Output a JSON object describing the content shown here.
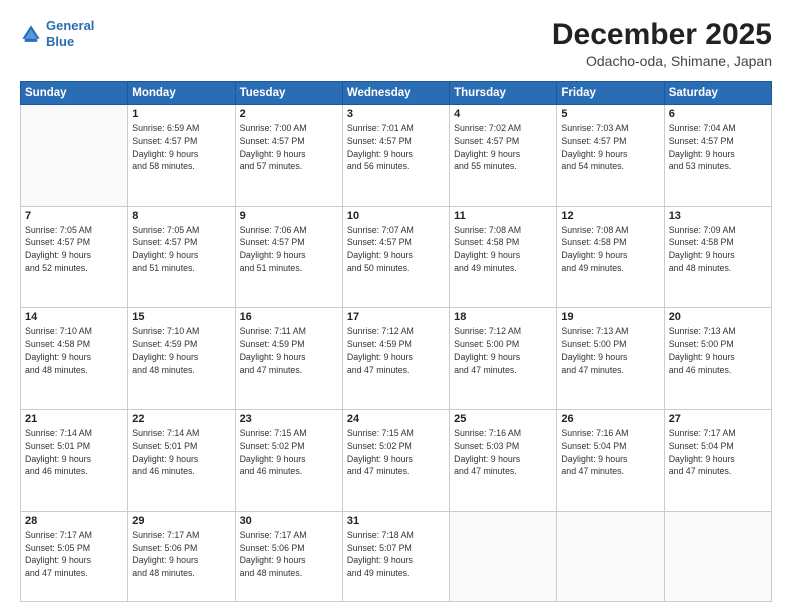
{
  "logo": {
    "line1": "General",
    "line2": "Blue"
  },
  "header": {
    "month": "December 2025",
    "location": "Odacho-oda, Shimane, Japan"
  },
  "weekdays": [
    "Sunday",
    "Monday",
    "Tuesday",
    "Wednesday",
    "Thursday",
    "Friday",
    "Saturday"
  ],
  "weeks": [
    [
      {
        "day": "",
        "info": ""
      },
      {
        "day": "1",
        "info": "Sunrise: 6:59 AM\nSunset: 4:57 PM\nDaylight: 9 hours\nand 58 minutes."
      },
      {
        "day": "2",
        "info": "Sunrise: 7:00 AM\nSunset: 4:57 PM\nDaylight: 9 hours\nand 57 minutes."
      },
      {
        "day": "3",
        "info": "Sunrise: 7:01 AM\nSunset: 4:57 PM\nDaylight: 9 hours\nand 56 minutes."
      },
      {
        "day": "4",
        "info": "Sunrise: 7:02 AM\nSunset: 4:57 PM\nDaylight: 9 hours\nand 55 minutes."
      },
      {
        "day": "5",
        "info": "Sunrise: 7:03 AM\nSunset: 4:57 PM\nDaylight: 9 hours\nand 54 minutes."
      },
      {
        "day": "6",
        "info": "Sunrise: 7:04 AM\nSunset: 4:57 PM\nDaylight: 9 hours\nand 53 minutes."
      }
    ],
    [
      {
        "day": "7",
        "info": "Sunrise: 7:05 AM\nSunset: 4:57 PM\nDaylight: 9 hours\nand 52 minutes."
      },
      {
        "day": "8",
        "info": "Sunrise: 7:05 AM\nSunset: 4:57 PM\nDaylight: 9 hours\nand 51 minutes."
      },
      {
        "day": "9",
        "info": "Sunrise: 7:06 AM\nSunset: 4:57 PM\nDaylight: 9 hours\nand 51 minutes."
      },
      {
        "day": "10",
        "info": "Sunrise: 7:07 AM\nSunset: 4:57 PM\nDaylight: 9 hours\nand 50 minutes."
      },
      {
        "day": "11",
        "info": "Sunrise: 7:08 AM\nSunset: 4:58 PM\nDaylight: 9 hours\nand 49 minutes."
      },
      {
        "day": "12",
        "info": "Sunrise: 7:08 AM\nSunset: 4:58 PM\nDaylight: 9 hours\nand 49 minutes."
      },
      {
        "day": "13",
        "info": "Sunrise: 7:09 AM\nSunset: 4:58 PM\nDaylight: 9 hours\nand 48 minutes."
      }
    ],
    [
      {
        "day": "14",
        "info": "Sunrise: 7:10 AM\nSunset: 4:58 PM\nDaylight: 9 hours\nand 48 minutes."
      },
      {
        "day": "15",
        "info": "Sunrise: 7:10 AM\nSunset: 4:59 PM\nDaylight: 9 hours\nand 48 minutes."
      },
      {
        "day": "16",
        "info": "Sunrise: 7:11 AM\nSunset: 4:59 PM\nDaylight: 9 hours\nand 47 minutes."
      },
      {
        "day": "17",
        "info": "Sunrise: 7:12 AM\nSunset: 4:59 PM\nDaylight: 9 hours\nand 47 minutes."
      },
      {
        "day": "18",
        "info": "Sunrise: 7:12 AM\nSunset: 5:00 PM\nDaylight: 9 hours\nand 47 minutes."
      },
      {
        "day": "19",
        "info": "Sunrise: 7:13 AM\nSunset: 5:00 PM\nDaylight: 9 hours\nand 47 minutes."
      },
      {
        "day": "20",
        "info": "Sunrise: 7:13 AM\nSunset: 5:00 PM\nDaylight: 9 hours\nand 46 minutes."
      }
    ],
    [
      {
        "day": "21",
        "info": "Sunrise: 7:14 AM\nSunset: 5:01 PM\nDaylight: 9 hours\nand 46 minutes."
      },
      {
        "day": "22",
        "info": "Sunrise: 7:14 AM\nSunset: 5:01 PM\nDaylight: 9 hours\nand 46 minutes."
      },
      {
        "day": "23",
        "info": "Sunrise: 7:15 AM\nSunset: 5:02 PM\nDaylight: 9 hours\nand 46 minutes."
      },
      {
        "day": "24",
        "info": "Sunrise: 7:15 AM\nSunset: 5:02 PM\nDaylight: 9 hours\nand 47 minutes."
      },
      {
        "day": "25",
        "info": "Sunrise: 7:16 AM\nSunset: 5:03 PM\nDaylight: 9 hours\nand 47 minutes."
      },
      {
        "day": "26",
        "info": "Sunrise: 7:16 AM\nSunset: 5:04 PM\nDaylight: 9 hours\nand 47 minutes."
      },
      {
        "day": "27",
        "info": "Sunrise: 7:17 AM\nSunset: 5:04 PM\nDaylight: 9 hours\nand 47 minutes."
      }
    ],
    [
      {
        "day": "28",
        "info": "Sunrise: 7:17 AM\nSunset: 5:05 PM\nDaylight: 9 hours\nand 47 minutes."
      },
      {
        "day": "29",
        "info": "Sunrise: 7:17 AM\nSunset: 5:06 PM\nDaylight: 9 hours\nand 48 minutes."
      },
      {
        "day": "30",
        "info": "Sunrise: 7:17 AM\nSunset: 5:06 PM\nDaylight: 9 hours\nand 48 minutes."
      },
      {
        "day": "31",
        "info": "Sunrise: 7:18 AM\nSunset: 5:07 PM\nDaylight: 9 hours\nand 49 minutes."
      },
      {
        "day": "",
        "info": ""
      },
      {
        "day": "",
        "info": ""
      },
      {
        "day": "",
        "info": ""
      }
    ]
  ]
}
